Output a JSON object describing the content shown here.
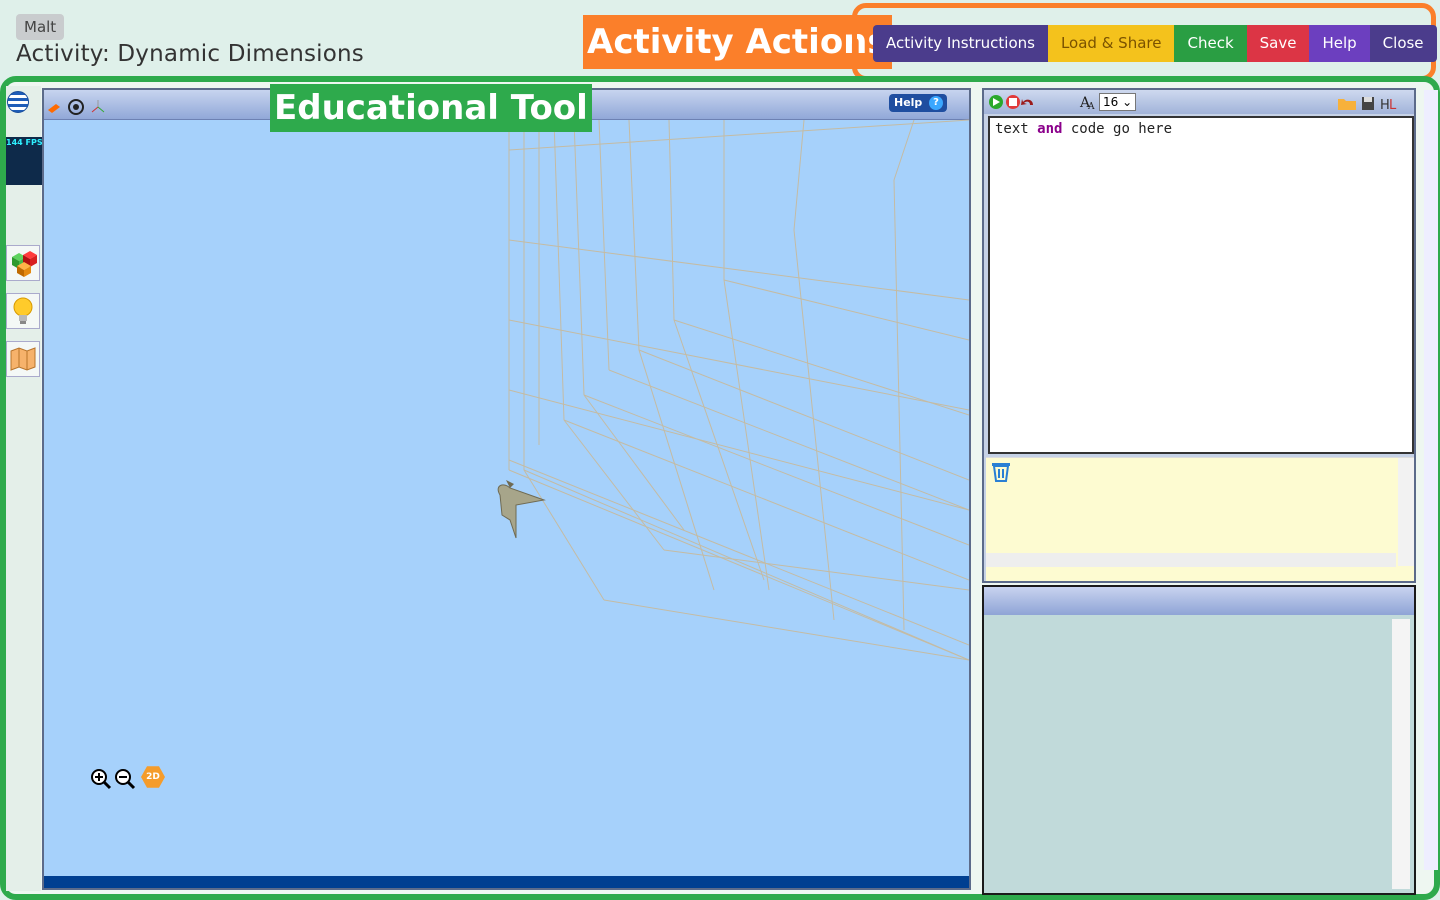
{
  "app": {
    "badge": "Malt",
    "title": "Activity: Dynamic Dimensions"
  },
  "overlay_labels": {
    "actions": "Activity Actions",
    "tool": "Educational Tool"
  },
  "actions": {
    "instructions": "Activity Instructions",
    "load_share": "Load & Share",
    "check": "Check",
    "save": "Save",
    "help": "Help",
    "close": "Close"
  },
  "viewport": {
    "fps": "144 FPS (140-144)",
    "help_label": "Help",
    "help_icon": "?",
    "view_mode": "2D"
  },
  "code_panel": {
    "font_size": "16",
    "editor_text_1": "text ",
    "editor_keyword": "and",
    "editor_text_2": " code go here"
  },
  "colors": {
    "actions_highlight": "#fb7f2a",
    "tool_highlight": "#2eaa4c",
    "viewport_bg": "#a6d1fb"
  }
}
